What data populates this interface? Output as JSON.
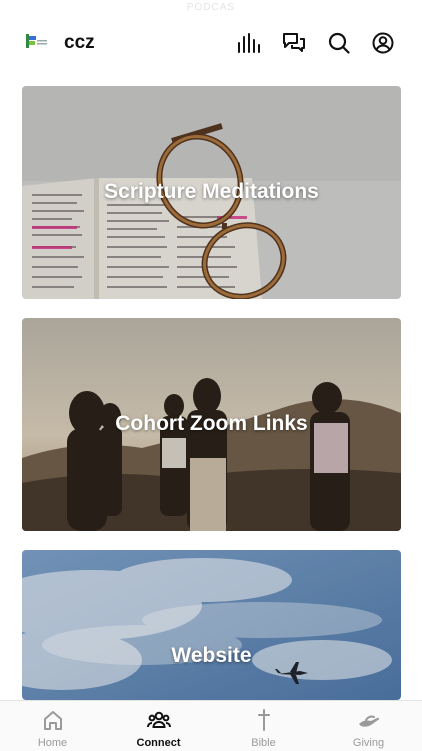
{
  "status_bar": {
    "text": "PODCAS"
  },
  "header": {
    "app_name": "ccz",
    "icons": [
      "equalizer-icon",
      "chat-bubbles-icon",
      "search-icon",
      "profile-icon"
    ]
  },
  "cards": [
    {
      "title": "Scripture Meditations",
      "image": "open-bible-with-glasses"
    },
    {
      "title": "Cohort Zoom Links",
      "image": "friends-on-hilltop-at-sunset"
    },
    {
      "title": "Website",
      "image": "airplane-in-cloudy-sky"
    }
  ],
  "tabbar": {
    "tabs": [
      {
        "label": "Home",
        "icon": "home-icon",
        "active": false
      },
      {
        "label": "Connect",
        "icon": "people-icon",
        "active": true
      },
      {
        "label": "Bible",
        "icon": "cross-icon",
        "active": false
      },
      {
        "label": "Giving",
        "icon": "giving-hand-icon",
        "active": false
      }
    ]
  },
  "colors": {
    "active_tab": "#111111",
    "inactive_tab": "#9a9a9a",
    "accent_pink": "#e0308a"
  }
}
